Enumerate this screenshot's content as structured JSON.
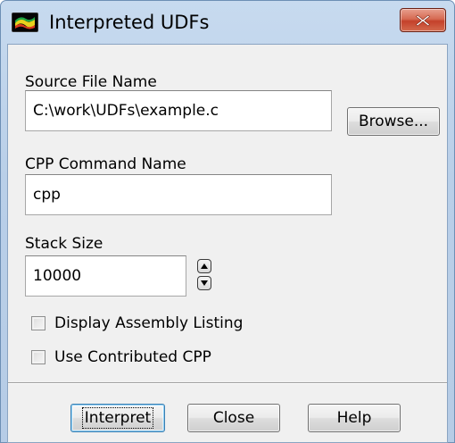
{
  "window": {
    "title": "Interpreted UDFs",
    "icon": "fluent-app-icon",
    "close_icon": "close-icon",
    "close_button_color": "#c4412a"
  },
  "form": {
    "source_file": {
      "label": "Source File Name",
      "value": "C:\\work\\UDFs\\example.c"
    },
    "browse_label": "Browse...",
    "cpp_command": {
      "label": "CPP Command Name",
      "value": "cpp"
    },
    "stack_size": {
      "label": "Stack Size",
      "value": "10000",
      "up_icon": "spin-up-icon",
      "down_icon": "spin-down-icon"
    },
    "options": [
      {
        "label": "Display Assembly Listing",
        "checked": false
      },
      {
        "label": "Use Contributed CPP",
        "checked": false
      }
    ]
  },
  "actions": {
    "interpret_label": "Interpret",
    "close_label": "Close",
    "help_label": "Help"
  }
}
